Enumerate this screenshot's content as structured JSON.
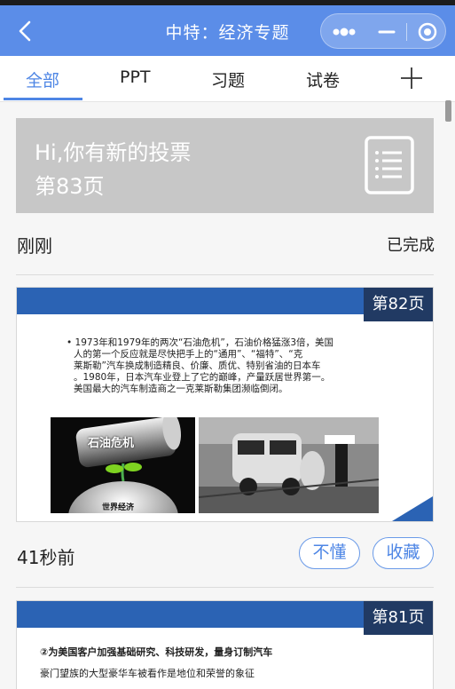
{
  "header": {
    "title": "中特：经济专题"
  },
  "tabs": [
    {
      "label": "全部",
      "active": true
    },
    {
      "label": "PPT",
      "active": false
    },
    {
      "label": "习题",
      "active": false
    },
    {
      "label": "试卷",
      "active": false
    }
  ],
  "banner": {
    "line1": "Hi,你有新的投票",
    "line2": "第83页",
    "icon": "document-icon"
  },
  "items": [
    {
      "time": "刚刚",
      "status": "已完成"
    },
    {
      "page": "第82页",
      "slide_lines": [
        "• 1973年和1979年的两次“石油危机”，石油价格猛涨3倍，美国",
        "人的第一个反应就是尽快把手上的“通用”、“福特”、“克",
        "莱斯勒”汽车换成制造精良、价廉、质优、特别省油的日本车",
        "。1980年，日本汽车业登上了它的巅峰，产量跃居世界第一。",
        "美国最大的汽车制造商之一克莱斯勒集团濒临倒闭。"
      ],
      "image_text_left": "石油危机",
      "image_text_bottom": "世界经济",
      "time": "41秒前",
      "btn_dont_understand": "不懂",
      "btn_favorite": "收藏"
    },
    {
      "page": "第81页",
      "slide_heading": "②为美国客户加强基础研究、科技研发，量身订制汽车",
      "slide_line": "豪门望族的大型豪华车被看作是地位和荣誉的象征"
    }
  ],
  "colors": {
    "header": "#5b8de8",
    "accent": "#4e86e5",
    "slide_blue": "#2b63b4",
    "badge": "#213a63"
  }
}
